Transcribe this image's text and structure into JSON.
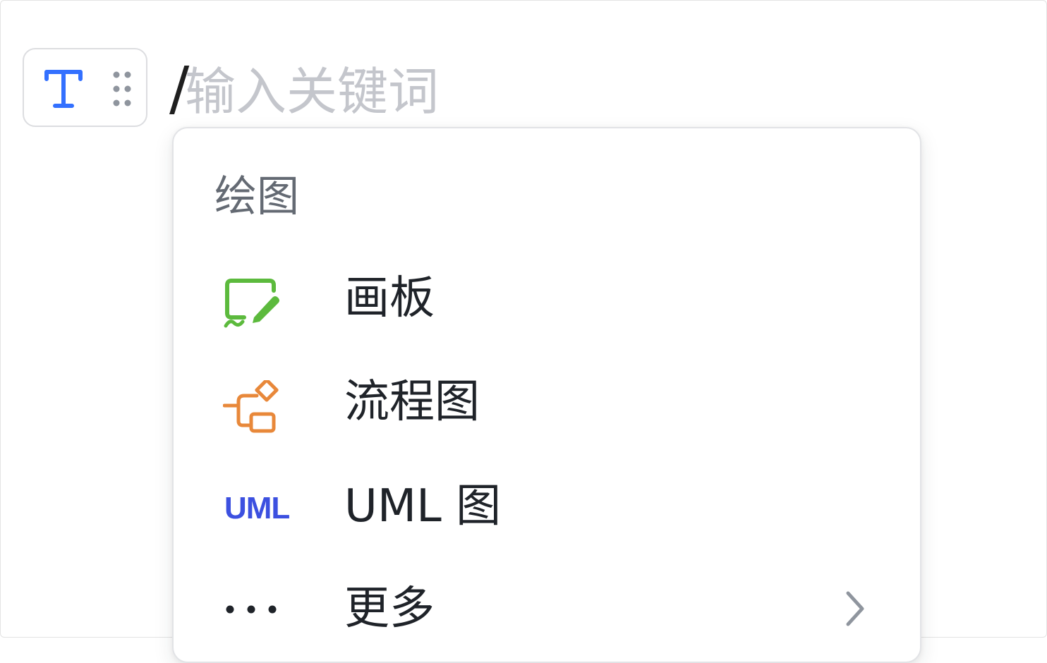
{
  "search": {
    "prefix": "/",
    "placeholder": "输入关键词",
    "value": ""
  },
  "block_handle": {
    "text_icon": "text-type-icon",
    "drag_icon": "drag-dots-icon"
  },
  "menu": {
    "group_title": "绘图",
    "items": [
      {
        "label": "画板",
        "icon": "whiteboard-icon",
        "icon_color": "#5cba3d"
      },
      {
        "label": "流程图",
        "icon": "flowchart-icon",
        "icon_color": "#e8883a"
      },
      {
        "label": "UML 图",
        "icon": "uml-icon",
        "icon_text": "UML",
        "icon_color": "#3c50e0"
      },
      {
        "label": "更多",
        "icon": "more-dots-icon",
        "has_submenu": true
      }
    ]
  },
  "colors": {
    "accent_blue": "#3370ff",
    "text_primary": "#1f2329",
    "text_secondary": "#646a73",
    "placeholder": "#c4c6cc",
    "border": "#e2e3e6"
  }
}
